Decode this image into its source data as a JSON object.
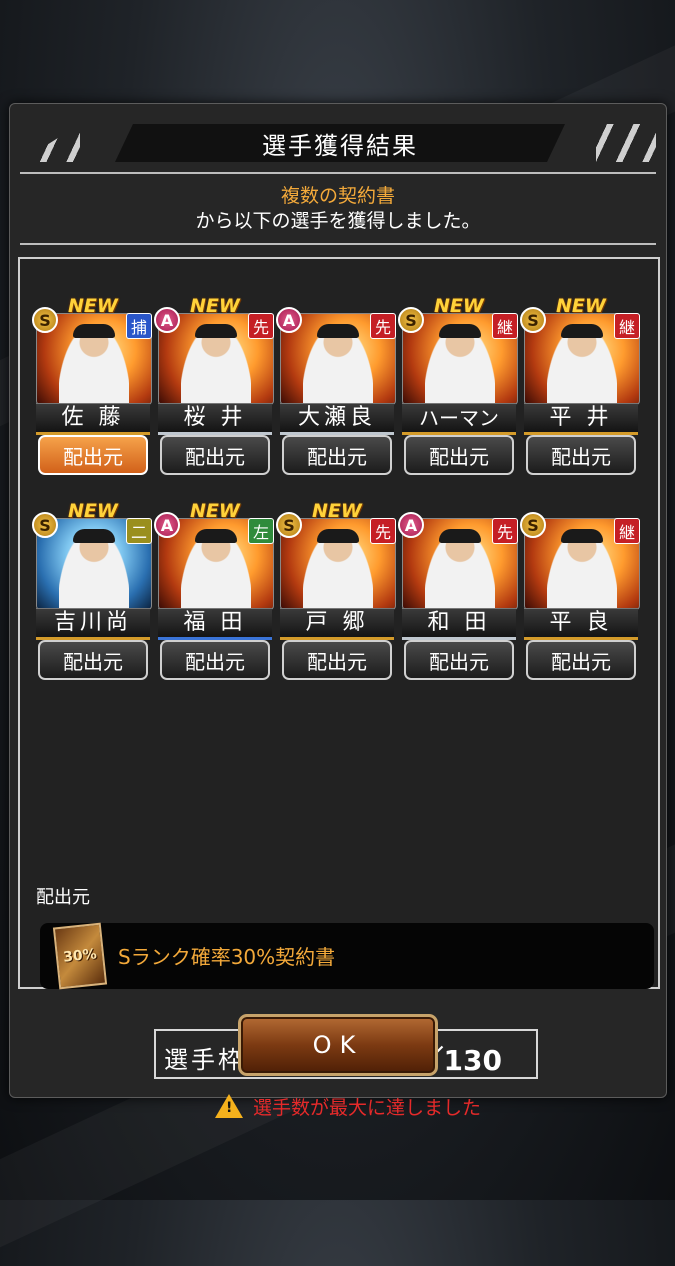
{
  "dialog": {
    "title": "選手獲得結果",
    "source_name_highlight": "複数の契約書",
    "message": "から以下の選手を獲得しました。"
  },
  "new_label": "NEW",
  "button_label": "配出元",
  "players": [
    {
      "rank": "S",
      "new": true,
      "position": "捕",
      "pos_color": "blue",
      "name": "佐 藤",
      "theme": "fire",
      "bar": "gold",
      "active": true
    },
    {
      "rank": "A",
      "new": true,
      "position": "先",
      "pos_color": "red",
      "name": "桜 井",
      "theme": "fire",
      "bar": "silver",
      "active": false
    },
    {
      "rank": "A",
      "new": false,
      "position": "先",
      "pos_color": "red",
      "name": "大瀬良",
      "theme": "fire",
      "bar": "silver",
      "active": false
    },
    {
      "rank": "S",
      "new": true,
      "position": "継",
      "pos_color": "red",
      "name": "ハーマン",
      "theme": "fire",
      "bar": "gold",
      "active": false
    },
    {
      "rank": "S",
      "new": true,
      "position": "継",
      "pos_color": "red",
      "name": "平 井",
      "theme": "fire",
      "bar": "gold",
      "active": false
    },
    {
      "rank": "S",
      "new": true,
      "position": "二",
      "pos_color": "olive",
      "name": "吉川尚",
      "theme": "ice",
      "bar": "gold",
      "active": false
    },
    {
      "rank": "A",
      "new": true,
      "position": "左",
      "pos_color": "green",
      "name": "福 田",
      "theme": "fire",
      "bar": "blue",
      "active": false
    },
    {
      "rank": "S",
      "new": true,
      "position": "先",
      "pos_color": "red",
      "name": "戸 郷",
      "theme": "fire",
      "bar": "gold",
      "active": false
    },
    {
      "rank": "A",
      "new": false,
      "position": "先",
      "pos_color": "red",
      "name": "和 田",
      "theme": "fire",
      "bar": "silver",
      "active": false
    },
    {
      "rank": "S",
      "new": false,
      "position": "継",
      "pos_color": "red",
      "name": "平 良",
      "theme": "fire",
      "bar": "gold",
      "active": false
    }
  ],
  "source": {
    "label": "配出元",
    "ticket_text": "30%",
    "name": "Sランク確率30%契約書"
  },
  "capacity": {
    "label": "選手枠：",
    "value": "130／130"
  },
  "warning": {
    "icon": "warning-icon",
    "text": "選手数が最大に達しました"
  },
  "ok_label": "OK",
  "colors": {
    "accent_orange": "#f3a93a",
    "warning_red": "#e52a2a",
    "active_button": "#f08c3a"
  }
}
